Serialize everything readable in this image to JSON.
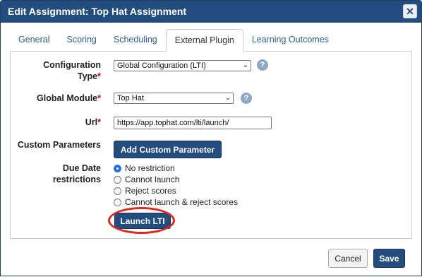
{
  "dialog": {
    "title": "Edit Assignment: Top Hat Assignment",
    "close_icon": "close-icon",
    "close_glyph": "✕"
  },
  "tabs": [
    {
      "label": "General"
    },
    {
      "label": "Scoring"
    },
    {
      "label": "Scheduling"
    },
    {
      "label": "External Plugin",
      "active": true
    },
    {
      "label": "Learning Outcomes"
    }
  ],
  "form": {
    "configuration_type": {
      "label_line1": "Configuration",
      "label_line2": "Type",
      "value": "Global Configuration (LTI)"
    },
    "global_module": {
      "label": "Global Module",
      "value": "Top Hat"
    },
    "url": {
      "label": "Url",
      "value": "https://app.tophat.com/lti/launch/"
    },
    "custom_parameters": {
      "label": "Custom Parameters",
      "button_label": "Add Custom Parameter"
    },
    "due_date": {
      "label_line1": "Due Date",
      "label_line2": "restrictions",
      "options": [
        {
          "label": "No restriction",
          "checked": true
        },
        {
          "label": "Cannot launch",
          "checked": false
        },
        {
          "label": "Reject scores",
          "checked": false
        },
        {
          "label": "Cannot launch & reject scores",
          "checked": false
        }
      ]
    },
    "required_mark": "*",
    "help_glyph": "?",
    "chevron_glyph": "⌄",
    "launch_button_label": "Launch LTI"
  },
  "footer": {
    "cancel_label": "Cancel",
    "save_label": "Save"
  },
  "colors": {
    "titlebar": "#234d7e",
    "primary_button": "#234d7e",
    "required": "#cc0000",
    "highlight_ring": "#e3261a",
    "tab_link": "#2c5f93"
  }
}
